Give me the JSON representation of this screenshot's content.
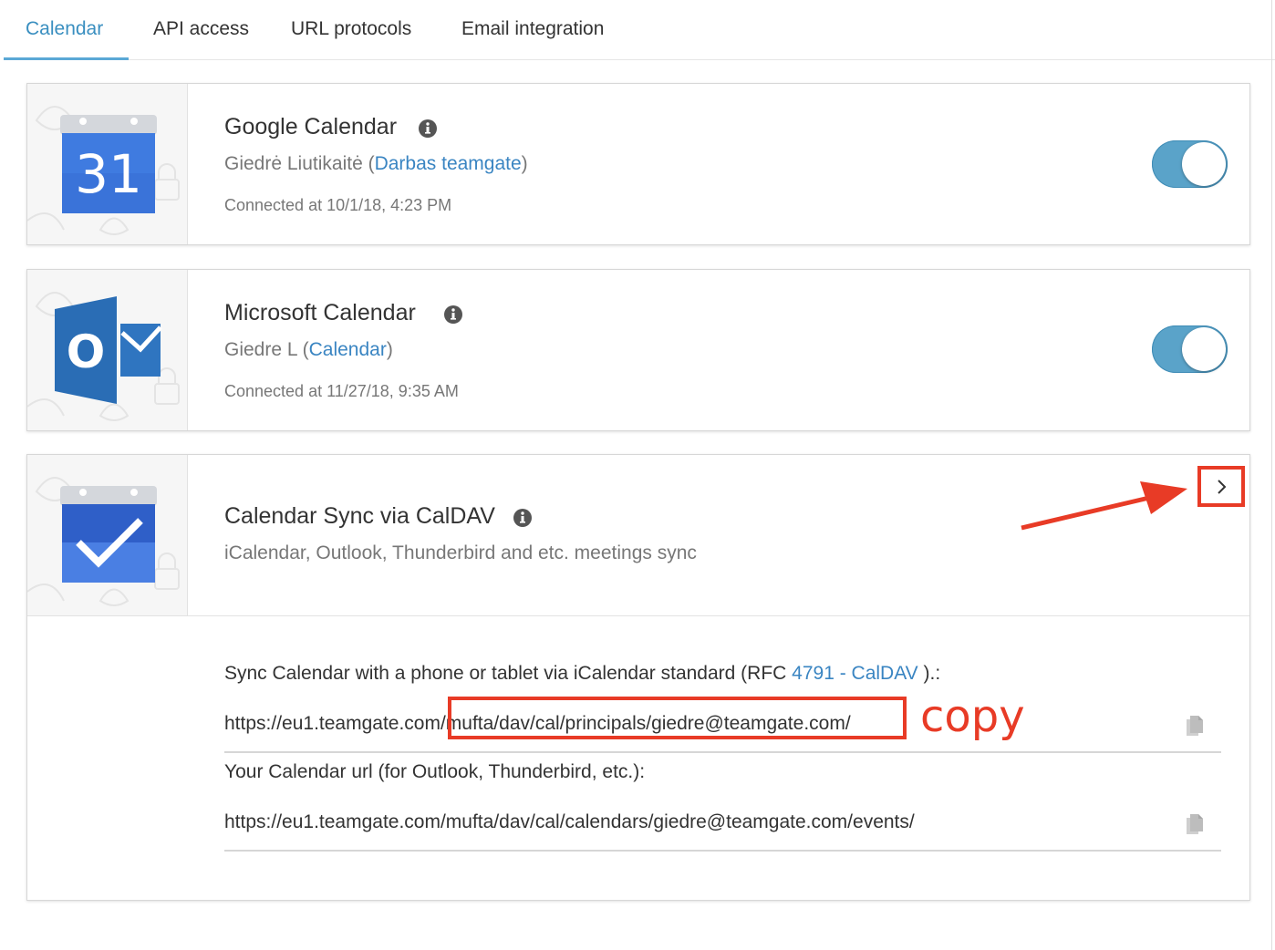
{
  "tabs": [
    {
      "label": "Calendar",
      "active": true
    },
    {
      "label": "API access",
      "active": false
    },
    {
      "label": "URL protocols",
      "active": false
    },
    {
      "label": "Email integration",
      "active": false
    }
  ],
  "google": {
    "title": "Google Calendar",
    "logo_text": "31",
    "user": "Giedrė Liutikaitė (",
    "account_link": "Darbas teamgate",
    "close_paren": ")",
    "connected": "Connected at 10/1/18, 4:23 PM",
    "enabled": true
  },
  "microsoft": {
    "title": "Microsoft Calendar",
    "logo_text": "O",
    "user": "Giedre L (",
    "account_link": "Calendar",
    "close_paren": ")",
    "connected": "Connected at 11/27/18, 9:35 AM",
    "enabled": true
  },
  "caldav": {
    "title": "Calendar Sync via CalDAV",
    "subtitle": "iCalendar, Outlook, Thunderbird and etc. meetings sync",
    "sync_text": "Sync Calendar with a phone or tablet via iCalendar standard (RFC ",
    "rfc_link": "4791 - CalDAV",
    "sync_text_end": " ).:",
    "principal_url": "https://eu1.teamgate.com/mufta/dav/cal/principals/giedre@teamgate.com/",
    "calendar_url_label": "Your Calendar url (for Outlook, Thunderbird, etc.):",
    "calendar_url": "https://eu1.teamgate.com/mufta/dav/cal/calendars/giedre@teamgate.com/events/",
    "annotation": "copy"
  },
  "colors": {
    "accent": "#3a8fc0",
    "toggle_on": "#5aa3c9",
    "annotation_red": "#e83b26",
    "google_blue": "#3b6fd8",
    "outlook_blue": "#2a6db5"
  },
  "icons": [
    "info-icon",
    "chevron-right-icon",
    "copy-icon",
    "google-calendar-logo",
    "outlook-logo",
    "caldav-check-logo"
  ]
}
